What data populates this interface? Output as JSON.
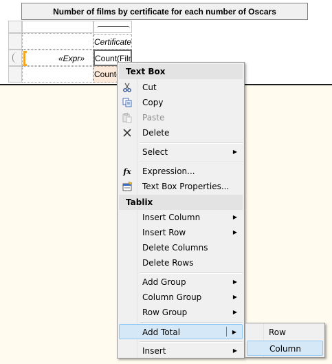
{
  "report": {
    "title": "Number of films by certificate for each number of Oscars",
    "header_cell": "Certificate",
    "row_group_cell": "«Expr»",
    "data_cell_1": "Count(FilmI",
    "data_cell_2": "Count(FilmI"
  },
  "context_menu": {
    "sections": {
      "text_box": "Text Box",
      "tablix": "Tablix"
    },
    "items": {
      "cut": "Cut",
      "copy": "Copy",
      "paste": "Paste",
      "delete": "Delete",
      "select": "Select",
      "expression": "Expression...",
      "text_box_properties": "Text Box Properties...",
      "insert_column": "Insert Column",
      "insert_row": "Insert Row",
      "delete_columns": "Delete Columns",
      "delete_rows": "Delete Rows",
      "add_group": "Add Group",
      "column_group": "Column Group",
      "row_group": "Row Group",
      "add_total": "Add Total",
      "insert": "Insert"
    },
    "submenu_arrow": "▶"
  },
  "add_total_submenu": {
    "row": "Row",
    "column": "Column"
  },
  "icons": {
    "cut": "scissors-icon",
    "copy": "copy-icon",
    "paste": "paste-icon",
    "delete": "delete-x-icon",
    "expression": "fx-icon",
    "text_box_properties": "properties-icon"
  },
  "colors": {
    "highlight": "#d5e8f7",
    "highlight_border": "#90c8f6",
    "body_background": "#fffbee",
    "selection_orange": "#f5a623",
    "data_cell_fill": "#fde9d9"
  }
}
